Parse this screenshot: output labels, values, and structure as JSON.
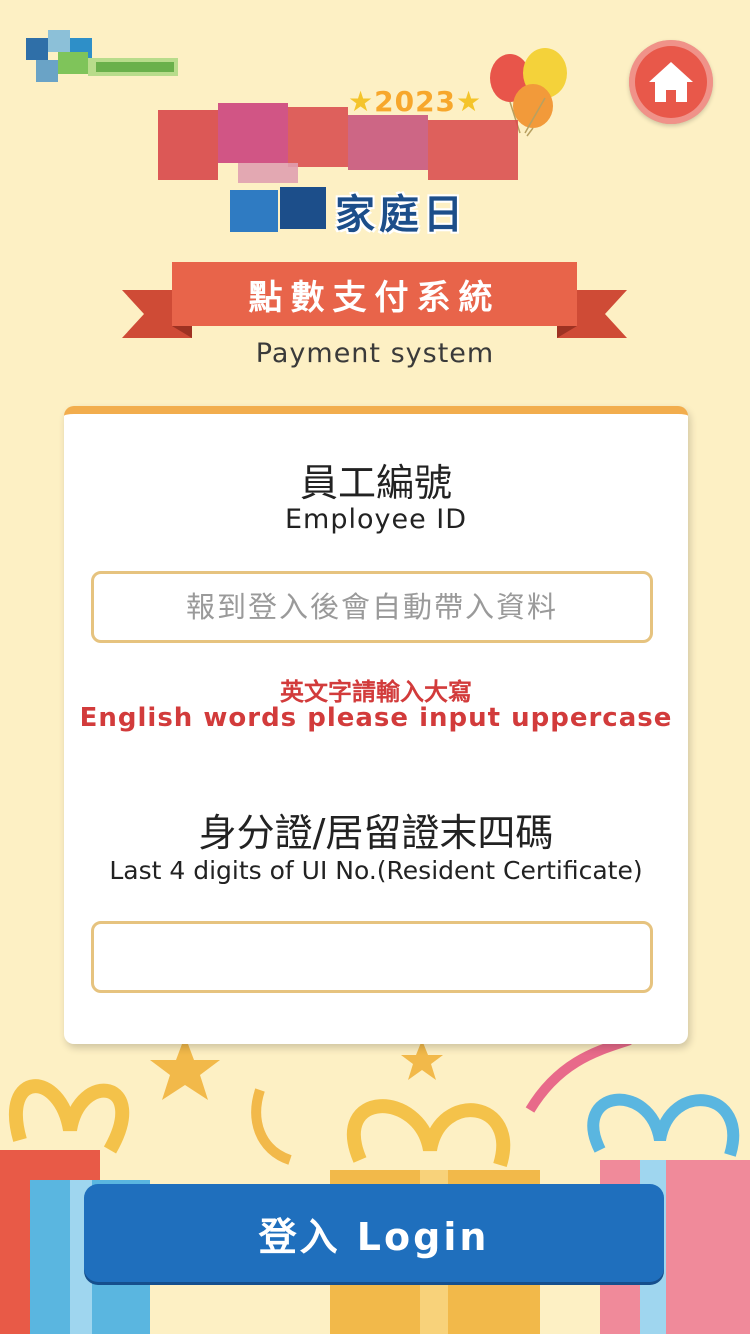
{
  "header": {
    "event_year": "2023",
    "event_family_text": "家庭日",
    "system_title_cn": "點數支付系統",
    "system_title_en": "Payment system"
  },
  "form": {
    "employee_id": {
      "label_cn": "員工編號",
      "label_en": "Employee ID",
      "placeholder": "報到登入後會自動帶入資料",
      "value": ""
    },
    "warning": {
      "cn": "英文字請輸入大寫",
      "en": "English words please input uppercase"
    },
    "id_digits": {
      "label_cn": "身分證/居留證末四碼",
      "label_en": "Last 4 digits of UI No.(Resident Certificate)",
      "placeholder": "",
      "value": ""
    }
  },
  "login_button": {
    "label": "登入 Login"
  },
  "icons": {
    "home": "home-icon",
    "balloons": "balloons-icon"
  },
  "colors": {
    "background": "#fdf0c4",
    "ribbon": "#e8644a",
    "card_top": "#f2ad4d",
    "warning": "#d23b3b",
    "button": "#1f6fbd"
  }
}
